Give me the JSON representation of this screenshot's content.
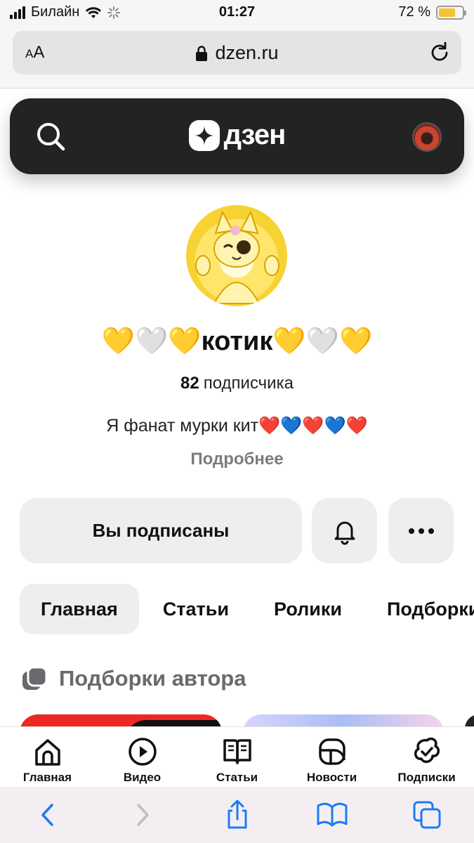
{
  "status_bar": {
    "carrier": "Билайн",
    "time": "01:27",
    "battery_percent": "72 %",
    "battery_level": 0.72
  },
  "browser": {
    "text_size_small": "A",
    "text_size_large": "A",
    "host": "dzen.ru"
  },
  "header": {
    "logo_text": "дзен"
  },
  "channel": {
    "name": "💛🤍💛котик💛🤍💛",
    "subscribers_count": "82",
    "subscribers_label": "подписчика",
    "description": "Я фанат мурки кит❤️💙❤️💙❤️",
    "more_link": "Подробнее"
  },
  "actions": {
    "subscribed_label": "Вы подписаны"
  },
  "tabs": [
    {
      "label": "Главная",
      "active": true
    },
    {
      "label": "Статьи",
      "active": false
    },
    {
      "label": "Ролики",
      "active": false
    },
    {
      "label": "Подборки",
      "active": false
    }
  ],
  "section": {
    "title": "Подборки автора"
  },
  "bottom_nav": [
    {
      "label": "Главная",
      "icon": "home-icon"
    },
    {
      "label": "Видео",
      "icon": "video-icon"
    },
    {
      "label": "Статьи",
      "icon": "articles-icon"
    },
    {
      "label": "Новости",
      "icon": "news-icon"
    },
    {
      "label": "Подписки",
      "icon": "subscriptions-icon"
    }
  ],
  "colors": {
    "header_bg": "#232323",
    "button_bg": "#eeeef0",
    "accent_blue": "#1a7cf5"
  }
}
